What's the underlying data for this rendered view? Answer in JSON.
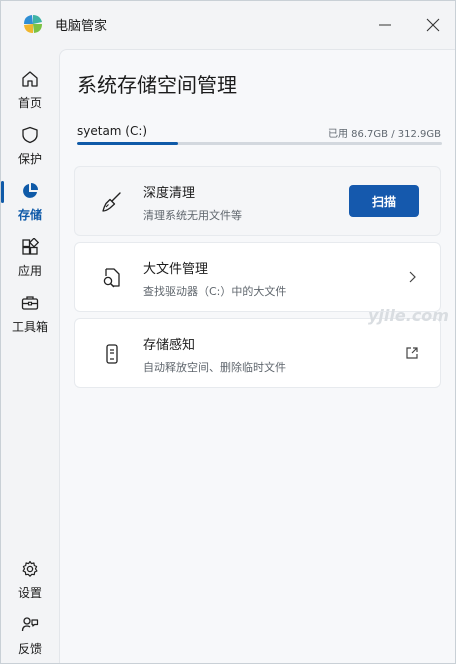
{
  "app": {
    "title": "电脑管家"
  },
  "sidebar": {
    "items": [
      {
        "label": "首页",
        "icon": "home-icon"
      },
      {
        "label": "保护",
        "icon": "shield-icon"
      },
      {
        "label": "存储",
        "icon": "pie-chart-icon",
        "active": true
      },
      {
        "label": "应用",
        "icon": "apps-icon"
      },
      {
        "label": "工具箱",
        "icon": "toolbox-icon"
      },
      {
        "label": "设置",
        "icon": "gear-icon"
      },
      {
        "label": "反馈",
        "icon": "feedback-icon"
      }
    ]
  },
  "main": {
    "title": "系统存储空间管理",
    "drive": {
      "name": "syetam (C:)",
      "usage_text": "已用 86.7GB / 312.9GB",
      "used_fraction": 0.277
    },
    "cards": [
      {
        "title": "深度清理",
        "subtitle": "清理系统无用文件等",
        "icon": "broom-icon",
        "action": "扫描"
      },
      {
        "title": "大文件管理",
        "subtitle": "查找驱动器（C:）中的大文件",
        "icon": "file-search-icon",
        "action_icon": "chevron-right-icon"
      },
      {
        "title": "存储感知",
        "subtitle": "自动释放空间、删除临时文件",
        "icon": "phone-storage-icon",
        "action_icon": "external-link-icon"
      }
    ]
  },
  "watermark": "yjile.com",
  "colors": {
    "accent": "#0f5aa8",
    "button": "#1559ad"
  }
}
